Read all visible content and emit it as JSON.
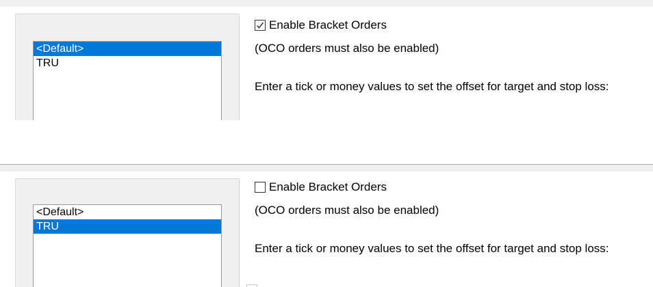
{
  "top_panel": {
    "instrument_list": [
      {
        "label": "<Default>",
        "selected": true
      },
      {
        "label": "TRU",
        "selected": false
      }
    ],
    "enable_bracket_orders": {
      "label": "Enable Bracket Orders",
      "checked": true
    },
    "oco_note": "(OCO orders must also be enabled)",
    "instructions": "Enter a tick or money values to set the offset for target and stop loss:"
  },
  "bottom_panel": {
    "instrument_list": [
      {
        "label": "<Default>",
        "selected": false
      },
      {
        "label": "TRU",
        "selected": true
      }
    ],
    "enable_bracket_orders": {
      "label": "Enable Bracket Orders",
      "checked": false
    },
    "oco_note": "(OCO orders must also be enabled)",
    "instructions": "Enter a tick or money values to set the offset for target and stop loss:"
  },
  "colors": {
    "selection": "#0078d7",
    "panel_background": "#f0f0f0"
  }
}
